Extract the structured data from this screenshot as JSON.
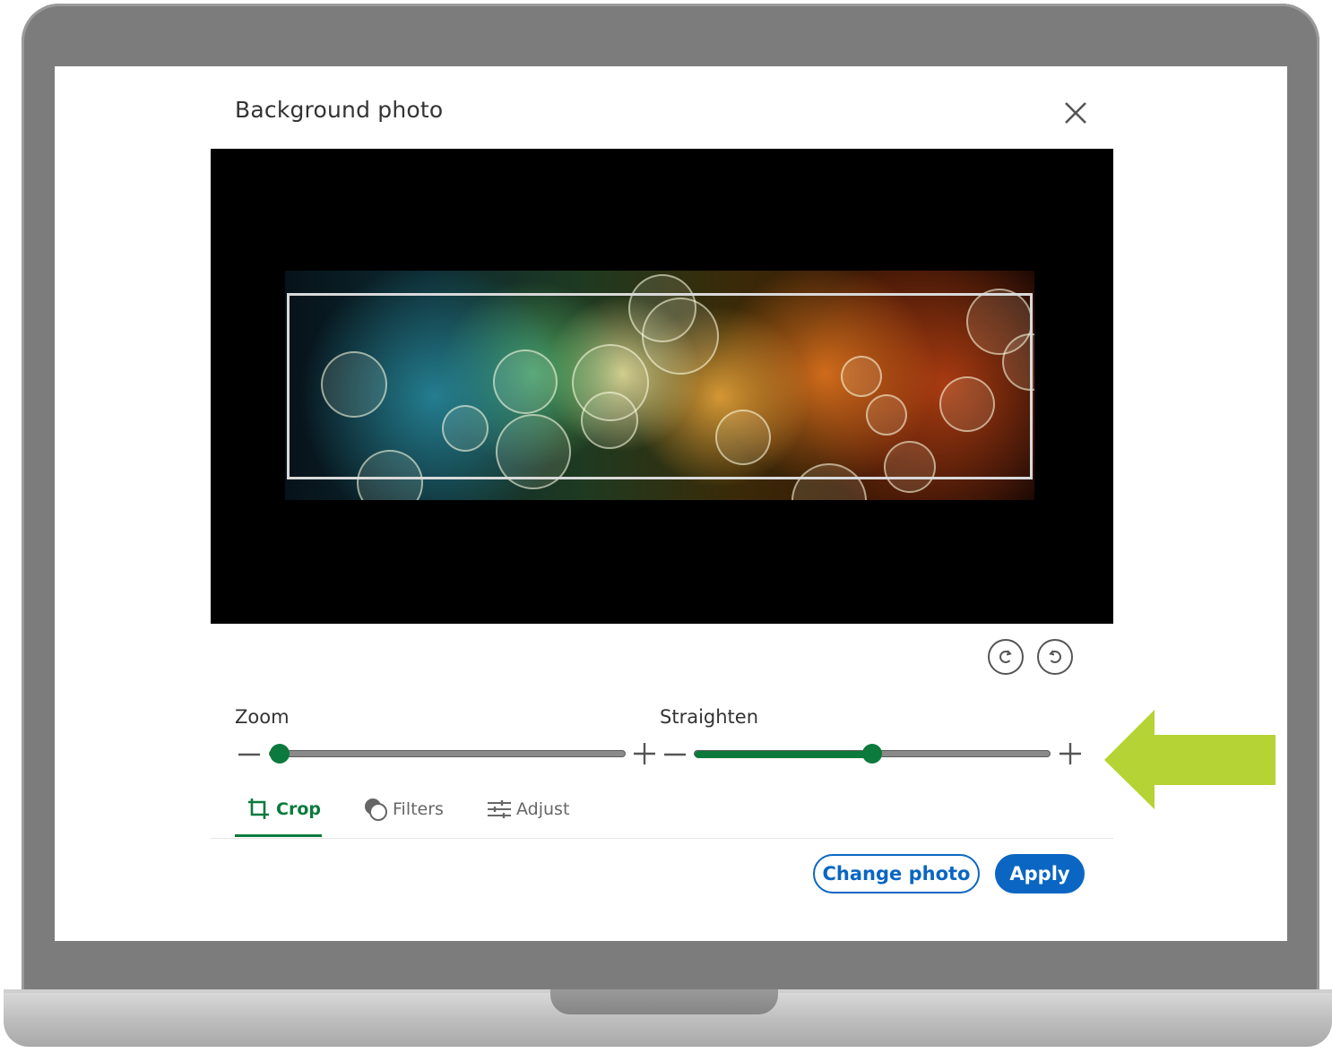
{
  "dialog": {
    "title": "Background photo"
  },
  "sliders": {
    "zoom": {
      "label": "Zoom",
      "value": 0.0
    },
    "straighten": {
      "label": "Straighten",
      "value": 0.5
    }
  },
  "tabs": [
    {
      "label": "Crop",
      "icon": "crop-icon",
      "active": true
    },
    {
      "label": "Filters",
      "icon": "filters-icon",
      "active": false
    },
    {
      "label": "Adjust",
      "icon": "adjust-icon",
      "active": false
    }
  ],
  "actions": {
    "change_photo": "Change photo",
    "apply": "Apply"
  },
  "colors": {
    "accent_green": "#0b7a3c",
    "primary_blue": "#0a66c2",
    "annotation_arrow": "#b5d334"
  }
}
